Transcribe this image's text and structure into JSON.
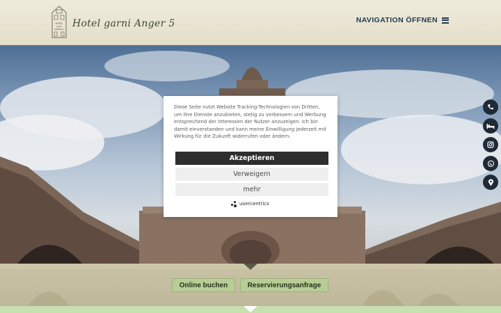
{
  "header": {
    "logo_text": "Hotel garni Anger 5",
    "logo_sign": [
      "HOTEL",
      "garni",
      "ANGER 5"
    ],
    "nav_label": "NAVIGATION ÖFFNEN"
  },
  "side_icons": [
    "phone-icon",
    "bed-icon",
    "instagram-icon",
    "whatsapp-icon",
    "map-pin-icon"
  ],
  "cookie": {
    "text": "Diese Seite nutzt Website Tracking-Technologien von Dritten, um ihre Dienste anzubieten, stetig zu verbessern und Werbung entsprechend der Interessen der Nutzer anzuzeigen. Ich bin damit einverstanden und kann meine Einwilligung jederzeit mit Wirkung für die Zukunft widerrufen oder ändern.",
    "accept_label": "Akzeptieren",
    "deny_label": "Verweigern",
    "more_label": "mehr",
    "brand": "usercentrics"
  },
  "booking": {
    "online_label": "Online buchen",
    "request_label": "Reservierungsanfrage"
  }
}
